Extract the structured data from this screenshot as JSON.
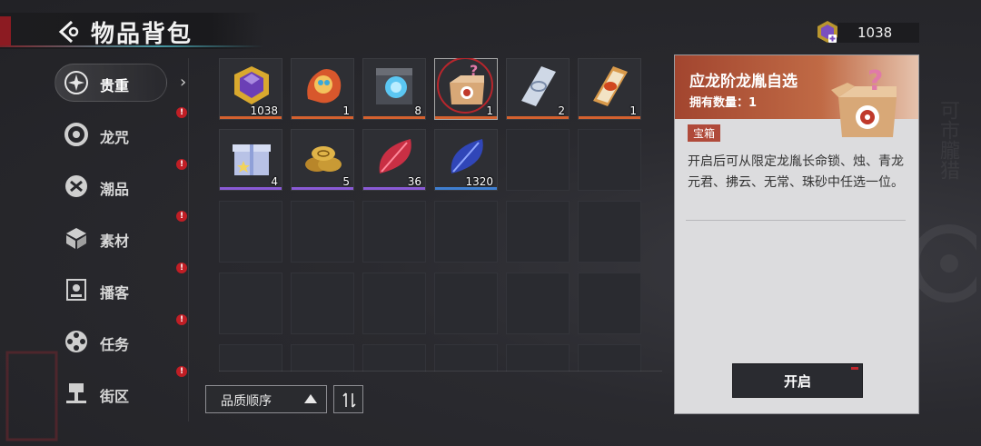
{
  "header": {
    "title": "物品背包"
  },
  "currency": {
    "value": "1038"
  },
  "sidebar": {
    "items": [
      {
        "label": "贵重",
        "icon": "star-burst-icon",
        "active": true,
        "badge": "!"
      },
      {
        "label": "龙咒",
        "icon": "ring-target-icon",
        "badge": "!"
      },
      {
        "label": "潮品",
        "icon": "hexagon-emblem-icon",
        "badge": "!"
      },
      {
        "label": "素材",
        "icon": "cube-stack-icon",
        "badge": "!"
      },
      {
        "label": "播客",
        "icon": "cassette-icon",
        "badge": "!"
      },
      {
        "label": "任务",
        "icon": "film-reel-icon",
        "badge": "!"
      },
      {
        "label": "街区",
        "icon": "district-icon"
      }
    ]
  },
  "inventory": {
    "items": [
      {
        "qty": "1038",
        "icon": "purple-gold-crystal-icon",
        "rarity": "#d4612f"
      },
      {
        "qty": "1",
        "icon": "fire-dragon-spirit-icon",
        "rarity": "#d4612f"
      },
      {
        "qty": "8",
        "icon": "blue-core-cube-icon",
        "rarity": "#d4612f"
      },
      {
        "qty": "1",
        "icon": "mystery-box-icon",
        "rarity": "#d4612f",
        "selected": true
      },
      {
        "qty": "2",
        "icon": "silver-ticket-icon",
        "rarity": "#d4612f"
      },
      {
        "qty": "1",
        "icon": "gold-ticket-icon",
        "rarity": "#d4612f"
      },
      {
        "qty": "4",
        "icon": "gift-box-icon",
        "rarity": "#8a5ad6"
      },
      {
        "qty": "5",
        "icon": "gold-coins-icon",
        "rarity": "#8a5ad6"
      },
      {
        "qty": "36",
        "icon": "red-leaf-gem-icon",
        "rarity": "#8a5ad6"
      },
      {
        "qty": "1320",
        "icon": "blue-leaf-gem-icon",
        "rarity": "#3f7fd1"
      }
    ]
  },
  "sort": {
    "label": "品质顺序"
  },
  "detail": {
    "title": "应龙阶龙胤自选",
    "owned": "拥有数量：1",
    "tag": "宝箱",
    "description": "开启后可从限定龙胤长命锁、烛、青龙元君、拂云、无常、珠砂中任选一位。",
    "open_label": "开启",
    "icon": "mystery-box-icon"
  }
}
